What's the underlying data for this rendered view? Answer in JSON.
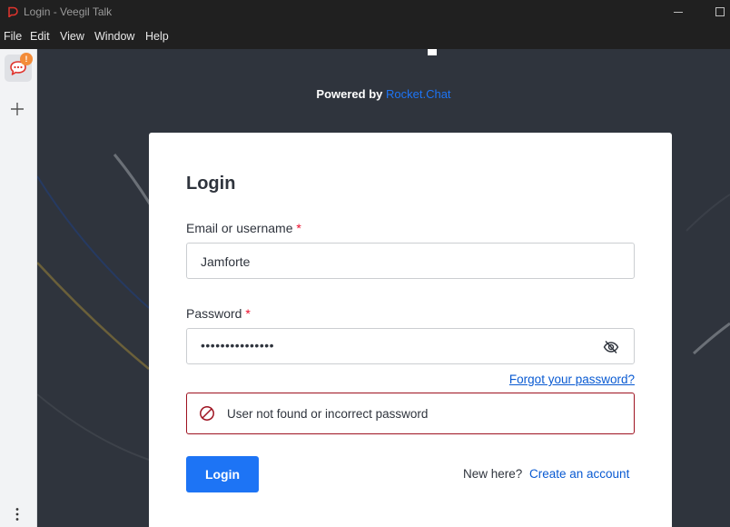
{
  "window": {
    "title": "Login - Veegil Talk"
  },
  "menu": {
    "items": [
      "File",
      "Edit",
      "View",
      "Window",
      "Help"
    ]
  },
  "rail": {
    "badge": "!",
    "icons": [
      "chat-bubble-icon",
      "plus-icon",
      "more-vertical-icon"
    ]
  },
  "branding": {
    "powered_by": "Powered by",
    "powered_link": "Rocket.Chat"
  },
  "login": {
    "title": "Login",
    "email_label": "Email or username",
    "required_marker": "*",
    "email_value": "Jamforte",
    "password_label": "Password",
    "password_value": "•••••••••••••••",
    "forgot_link": "Forgot your password?",
    "error_message": "User not found or incorrect password",
    "login_button": "Login",
    "new_here": "New here?",
    "create_account": "Create an account"
  },
  "colors": {
    "accent": "#1d74f5",
    "link": "#095ad2",
    "error_border": "#9e1220",
    "background": "#2f343d",
    "badge": "#f38c39"
  }
}
